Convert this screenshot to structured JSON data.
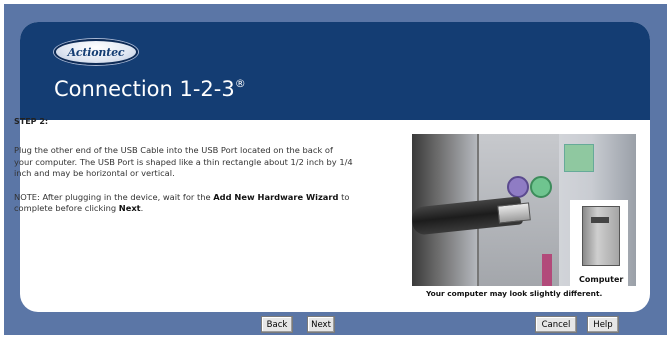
{
  "brand": {
    "logo_text": "Actiontec",
    "title": "Connection 1-2-3",
    "title_mark": "®"
  },
  "content": {
    "step_label": "STEP 2:",
    "instructions": "Plug the other end of the USB Cable into the USB Port located on the back of your computer. The USB Port is shaped like a thin rectangle about 1/2 inch by 1/4 inch and may be horizontal or vertical.",
    "note_prefix": "NOTE: After plugging in the device, wait for the ",
    "note_bold1": "Add New Hardware Wizard",
    "note_middle": " to complete before clicking ",
    "note_bold2": "Next",
    "note_end": "."
  },
  "image": {
    "inset_label": "Computer",
    "caption": "Your computer may look slightly different."
  },
  "buttons": {
    "back": "Back",
    "next": "Next",
    "cancel": "Cancel",
    "help": "Help"
  },
  "colors": {
    "frame": "#5b76a6",
    "header": "#143d73",
    "panel": "#ffffff"
  }
}
